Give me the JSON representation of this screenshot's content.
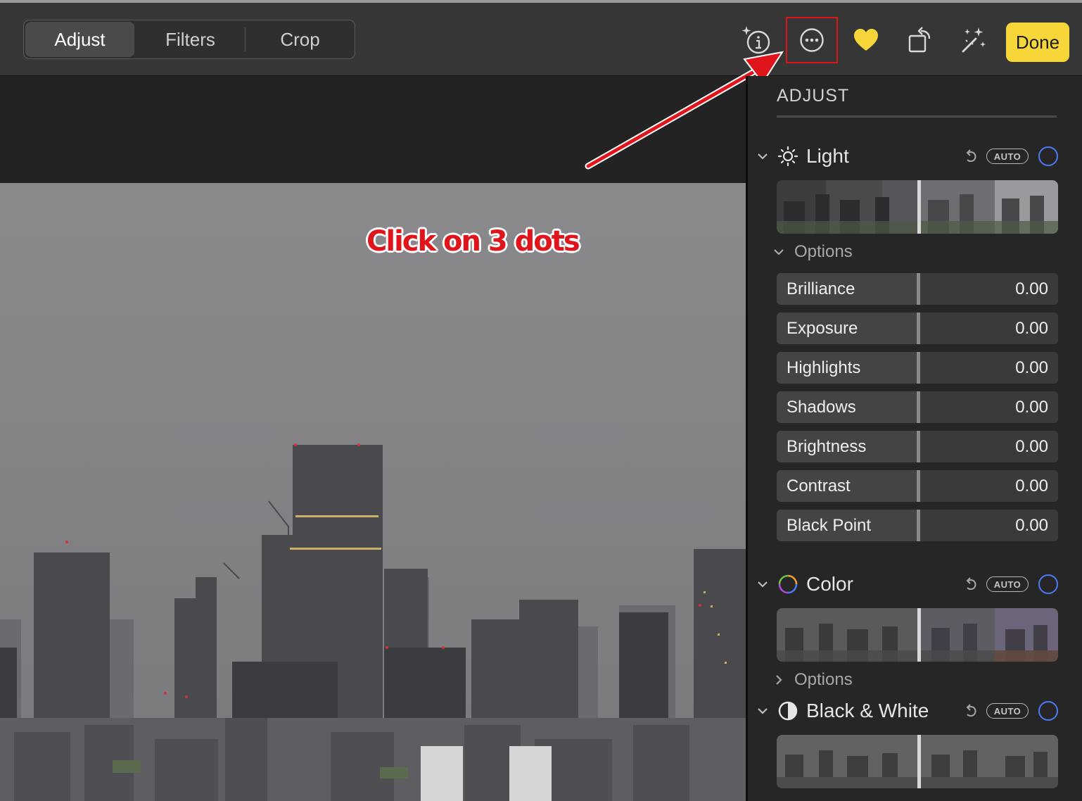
{
  "toolbar": {
    "tabs": [
      {
        "label": "Adjust",
        "active": true
      },
      {
        "label": "Filters",
        "active": false
      },
      {
        "label": "Crop",
        "active": false
      }
    ],
    "icons": [
      "info-sparkle-icon",
      "more-options-icon",
      "favorite-heart-icon",
      "rotate-icon",
      "auto-enhance-icon"
    ],
    "done_label": "Done",
    "colors": {
      "done_bg": "#f7d639",
      "heart": "#f7d639",
      "highlight": "#e0141b"
    }
  },
  "annotation": {
    "text": "Click on 3 dots",
    "color": "#e0141b"
  },
  "sidebar": {
    "title": "ADJUST",
    "sections": [
      {
        "name": "Light",
        "icon": "sun-icon",
        "auto_label": "AUTO",
        "expanded": true,
        "options_label": "Options",
        "options_expanded": true,
        "sliders": [
          {
            "label": "Brilliance",
            "value": "0.00"
          },
          {
            "label": "Exposure",
            "value": "0.00"
          },
          {
            "label": "Highlights",
            "value": "0.00"
          },
          {
            "label": "Shadows",
            "value": "0.00"
          },
          {
            "label": "Brightness",
            "value": "0.00"
          },
          {
            "label": "Contrast",
            "value": "0.00"
          },
          {
            "label": "Black Point",
            "value": "0.00"
          }
        ]
      },
      {
        "name": "Color",
        "icon": "color-wheel-icon",
        "auto_label": "AUTO",
        "expanded": true,
        "options_label": "Options",
        "options_expanded": false
      },
      {
        "name": "Black & White",
        "icon": "half-circle-icon",
        "auto_label": "AUTO",
        "expanded": true
      }
    ],
    "colors": {
      "toggle": "#4b7cf5"
    }
  }
}
